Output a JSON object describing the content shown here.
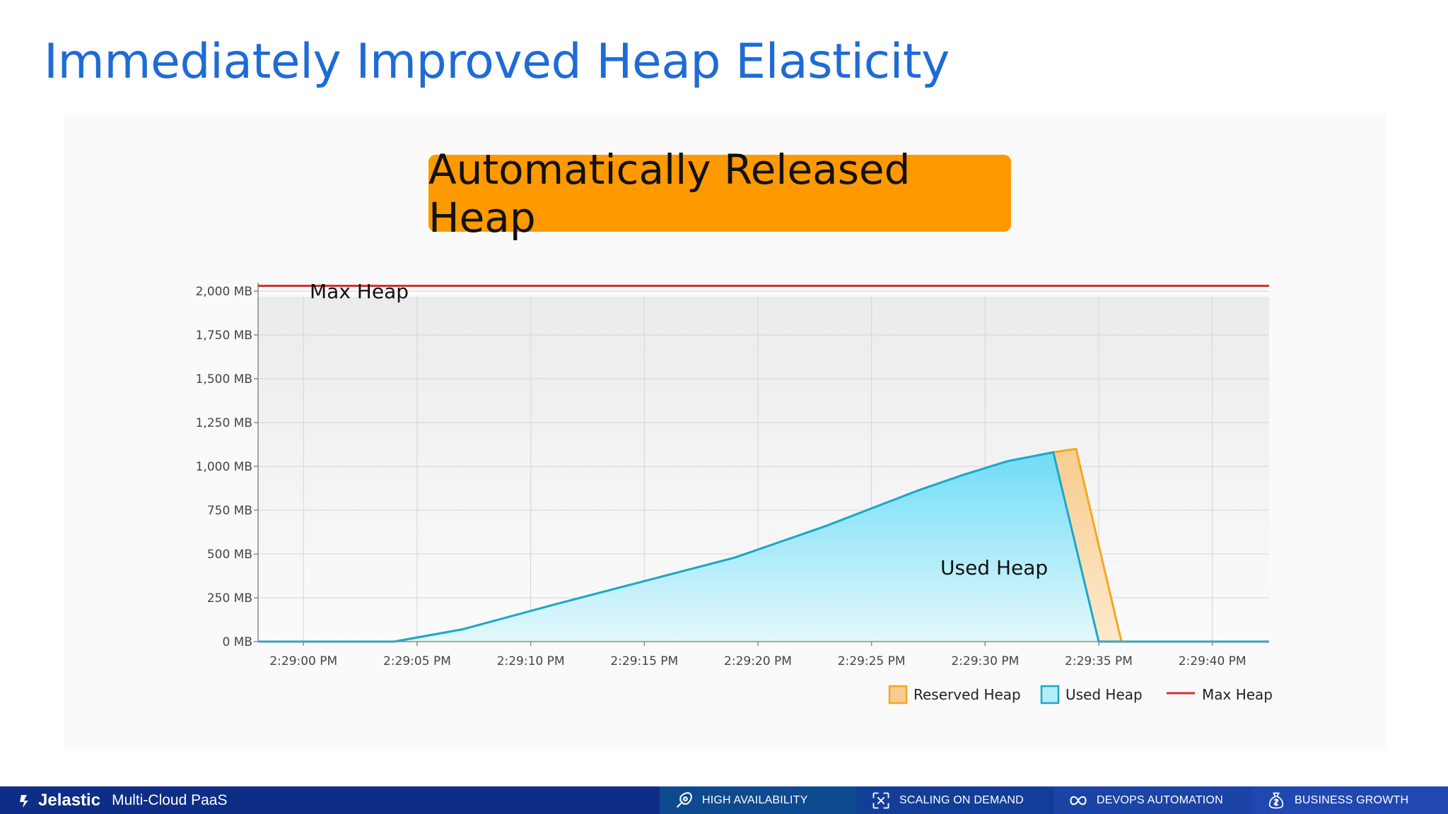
{
  "slide": {
    "title": "Immediately Improved Heap Elasticity",
    "callout": "Automatically Released Heap"
  },
  "chart_data": {
    "type": "area",
    "x": [
      "2:29:00 PM",
      "2:29:05 PM",
      "2:29:10 PM",
      "2:29:15 PM",
      "2:29:20 PM",
      "2:29:25 PM",
      "2:29:30 PM",
      "2:29:35 PM",
      "2:29:40 PM"
    ],
    "y_ticks": [
      "0 MB",
      "250 MB",
      "500 MB",
      "750 MB",
      "1,000 MB",
      "1,250 MB",
      "1,500 MB",
      "1,750 MB",
      "2,000 MB"
    ],
    "ylim": [
      0,
      2000
    ],
    "xlim_seconds": [
      -2,
      42.5
    ],
    "grid": true,
    "legend_position": "bottom-right",
    "series": [
      {
        "name": "Reserved Heap",
        "color": "#f5a623",
        "points": [
          [
            -2,
            0
          ],
          [
            4,
            0
          ],
          [
            7,
            70
          ],
          [
            11,
            210
          ],
          [
            15,
            345
          ],
          [
            19,
            480
          ],
          [
            21,
            570
          ],
          [
            23,
            660
          ],
          [
            25,
            760
          ],
          [
            27,
            860
          ],
          [
            29,
            950
          ],
          [
            31,
            1030
          ],
          [
            33,
            1080
          ],
          [
            34,
            1100
          ],
          [
            36,
            0
          ],
          [
            42.5,
            0
          ]
        ]
      },
      {
        "name": "Used Heap",
        "color": "#1aa7c9",
        "points": [
          [
            -2,
            0
          ],
          [
            4,
            0
          ],
          [
            7,
            70
          ],
          [
            11,
            210
          ],
          [
            15,
            345
          ],
          [
            19,
            480
          ],
          [
            21,
            570
          ],
          [
            23,
            660
          ],
          [
            25,
            760
          ],
          [
            27,
            860
          ],
          [
            29,
            950
          ],
          [
            31,
            1030
          ],
          [
            33,
            1080
          ],
          [
            35,
            0
          ],
          [
            42.5,
            0
          ]
        ]
      },
      {
        "name": "Max Heap",
        "color": "#d32f2f",
        "points": [
          [
            -2,
            2030
          ],
          [
            42.5,
            2030
          ]
        ]
      }
    ],
    "annotations": [
      {
        "text": "Max Heap",
        "x": 0,
        "y": 2090
      },
      {
        "text": "Used Heap",
        "x": 29,
        "y": 450
      }
    ],
    "legend": [
      "Reserved Heap",
      "Used Heap",
      "Max Heap"
    ]
  },
  "footer": {
    "brand": "Jelastic",
    "tagline": "Multi-Cloud PaaS",
    "items": [
      {
        "label": "HIGH AVAILABILITY",
        "icon": "rocket-icon",
        "bg": "#0e4a8f"
      },
      {
        "label": "SCALING ON DEMAND",
        "icon": "scaling-icon",
        "bg": "#123e9a"
      },
      {
        "label": "DEVOPS AUTOMATION",
        "icon": "infinity-icon",
        "bg": "#1b44a6"
      },
      {
        "label": "BUSINESS GROWTH",
        "icon": "money-bag-icon",
        "bg": "#2048b0"
      }
    ]
  }
}
